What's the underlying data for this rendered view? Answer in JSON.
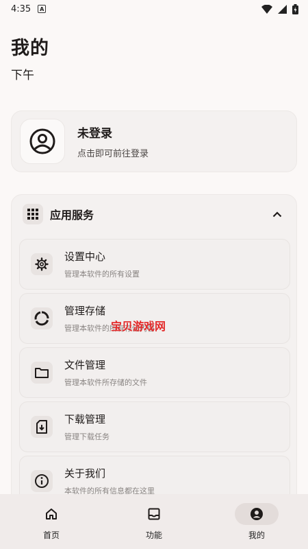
{
  "status_bar": {
    "time": "4:35",
    "notification_icon": "a-letter-icon"
  },
  "header": {
    "title": "我的",
    "subtitle": "下午"
  },
  "login_card": {
    "title": "未登录",
    "subtitle": "点击即可前往登录"
  },
  "services": {
    "title": "应用服务",
    "items": [
      {
        "title": "设置中心",
        "desc": "管理本软件的所有设置",
        "icon": "gear-icon"
      },
      {
        "title": "管理存储",
        "desc": "管理本软件的所有存储内容",
        "icon": "storage-donut-icon"
      },
      {
        "title": "文件管理",
        "desc": "管理本软件所存储的文件",
        "icon": "folder-icon"
      },
      {
        "title": "下载管理",
        "desc": "管理下载任务",
        "icon": "download-file-icon"
      },
      {
        "title": "关于我们",
        "desc": "本软件的所有信息都在这里",
        "icon": "info-icon"
      }
    ]
  },
  "watermark": "宝贝游戏网",
  "bottom_nav": {
    "items": [
      {
        "label": "首页",
        "icon": "home-icon"
      },
      {
        "label": "功能",
        "icon": "inbox-icon"
      },
      {
        "label": "我的",
        "icon": "account-circle-icon"
      }
    ],
    "active": "我的"
  }
}
